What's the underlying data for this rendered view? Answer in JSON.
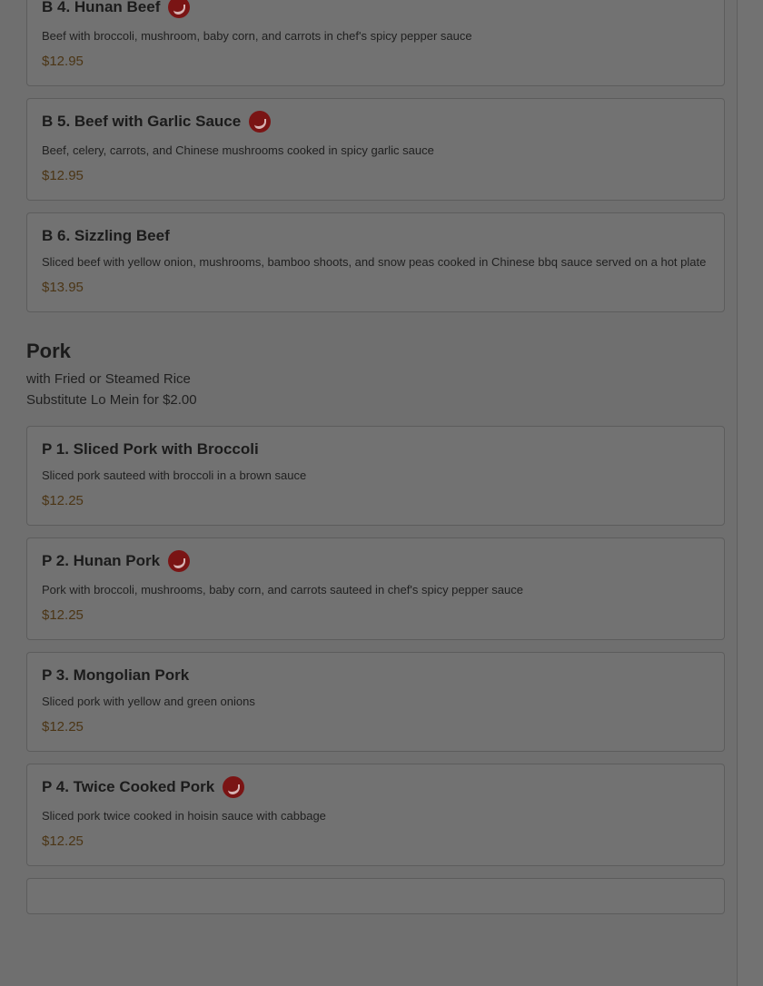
{
  "sections": {
    "beef_items": [
      {
        "name": "B 4. Hunan Beef",
        "desc": "Beef with broccoli, mushroom, baby corn, and carrots in chef's spicy pepper sauce",
        "price": "$12.95",
        "spicy_icon": "spicy-pepper-icon"
      },
      {
        "name": "B 5. Beef with Garlic Sauce",
        "desc": "Beef, celery, carrots, and Chinese mushrooms cooked in spicy garlic sauce",
        "price": "$12.95",
        "spicy_icon": "spicy-pepper-icon"
      },
      {
        "name": "B 6. Sizzling Beef",
        "desc": "Sliced beef with yellow onion, mushrooms, bamboo shoots, and snow peas cooked in Chinese bbq sauce served on a hot plate",
        "price": "$13.95"
      }
    ],
    "pork": {
      "title": "Pork",
      "note_line1": "with Fried or Steamed Rice",
      "note_line2": "Substitute Lo Mein for $2.00",
      "items": [
        {
          "name": "P 1. Sliced Pork with Broccoli",
          "desc": "Sliced pork sauteed with broccoli in a brown sauce",
          "price": "$12.25"
        },
        {
          "name": "P 2. Hunan Pork",
          "desc": "Pork with broccoli, mushrooms, baby corn, and carrots sauteed in chef's spicy pepper sauce",
          "price": "$12.25",
          "spicy_icon": "spicy-pepper-icon"
        },
        {
          "name": "P 3. Mongolian Pork",
          "desc": "Sliced pork with yellow and green onions",
          "price": "$12.25"
        },
        {
          "name": "P 4. Twice Cooked Pork",
          "desc": "Sliced pork twice cooked in hoisin sauce with cabbage",
          "price": "$12.25",
          "spicy_icon": "spicy-pepper-icon"
        }
      ]
    }
  },
  "colors": {
    "overlay_bg": "#6f6f6f",
    "price": "#4b3515",
    "spicy_badge": "#7a1414"
  }
}
